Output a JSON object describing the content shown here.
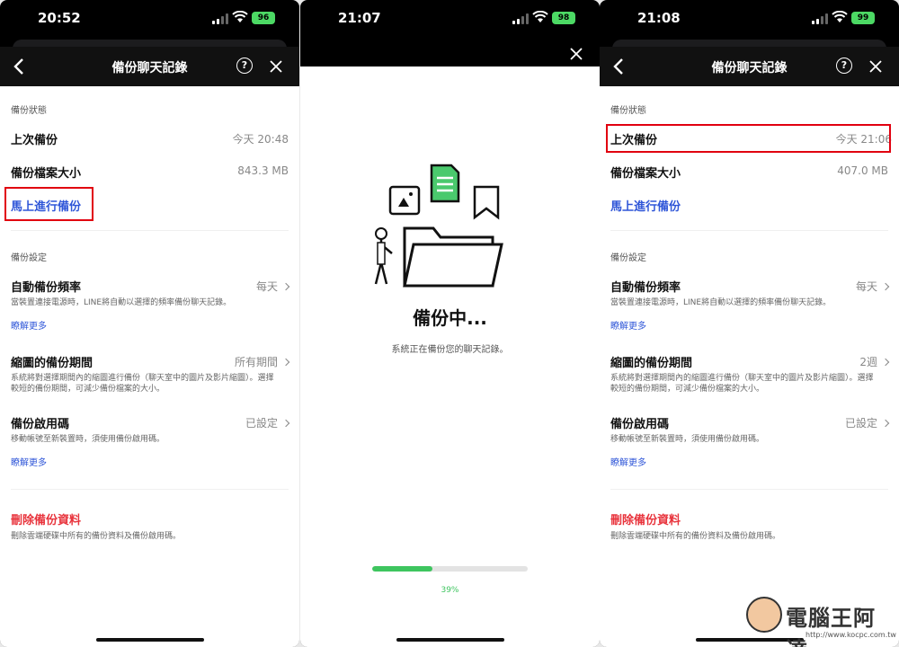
{
  "colors": {
    "accent_link": "#2f56d8",
    "danger": "#e8333c",
    "progress": "#3ec55f",
    "highlight": "#e1000f",
    "battery": "#4cd964"
  },
  "screens": [
    {
      "status": {
        "time": "20:52",
        "battery": "96"
      },
      "nav": {
        "title": "備份聊天記錄",
        "help": "?"
      },
      "backup_status": {
        "section_label": "備份狀態",
        "last_backup_label": "上次備份",
        "last_backup_value": "今天 20:48",
        "size_label": "備份檔案大小",
        "size_value": "843.3 MB",
        "backup_now": "馬上進行備份"
      },
      "backup_settings": {
        "section_label": "備份設定",
        "auto_freq_label": "自動備份頻率",
        "auto_freq_value": "每天",
        "auto_freq_desc": "當裝置連接電源時，LINE將自動以選擇的頻率備份聊天記錄。",
        "learn_more": "瞭解更多",
        "thumb_label": "縮圖的備份期間",
        "thumb_value": "所有期間",
        "thumb_desc": "系統將對選擇期間內的縮圖進行備份（聊天室中的圖片及影片縮圖）。選擇較短的備份期間，可減少備份檔案的大小。",
        "pin_label": "備份啟用碼",
        "pin_value": "已設定",
        "pin_desc": "移動帳號至新裝置時，須使用備份啟用碼。",
        "learn_more_2": "瞭解更多"
      },
      "delete": {
        "label": "刪除備份資料",
        "desc": "刪除雲端硬碟中所有的備份資料及備份啟用碼。"
      }
    },
    {
      "status": {
        "time": "21:07",
        "battery": "98"
      },
      "title": "備份中...",
      "subtitle": "系統正在備份您的聊天記錄。",
      "progress_percent": 39,
      "progress_text": "39%"
    },
    {
      "status": {
        "time": "21:08",
        "battery": "99"
      },
      "nav": {
        "title": "備份聊天記錄",
        "help": "?"
      },
      "backup_status": {
        "section_label": "備份狀態",
        "last_backup_label": "上次備份",
        "last_backup_value": "今天 21:06",
        "size_label": "備份檔案大小",
        "size_value": "407.0 MB",
        "backup_now": "馬上進行備份"
      },
      "backup_settings": {
        "section_label": "備份設定",
        "auto_freq_label": "自動備份頻率",
        "auto_freq_value": "每天",
        "auto_freq_desc": "當裝置連接電源時，LINE將自動以選擇的頻率備份聊天記錄。",
        "learn_more": "瞭解更多",
        "thumb_label": "縮圖的備份期間",
        "thumb_value": "2週",
        "thumb_desc": "系統將對選擇期間內的縮圖進行備份（聊天室中的圖片及影片縮圖）。選擇較短的備份期間，可減少備份檔案的大小。",
        "pin_label": "備份啟用碼",
        "pin_value": "已設定",
        "pin_desc": "移動帳號至新裝置時，須使用備份啟用碼。",
        "learn_more_2": "瞭解更多"
      },
      "delete": {
        "label": "刪除備份資料",
        "desc": "刪除雲端硬碟中所有的備份資料及備份啟用碼。"
      }
    }
  ],
  "watermark": {
    "text": "電腦王阿達",
    "url": "http://www.kocpc.com.tw"
  }
}
